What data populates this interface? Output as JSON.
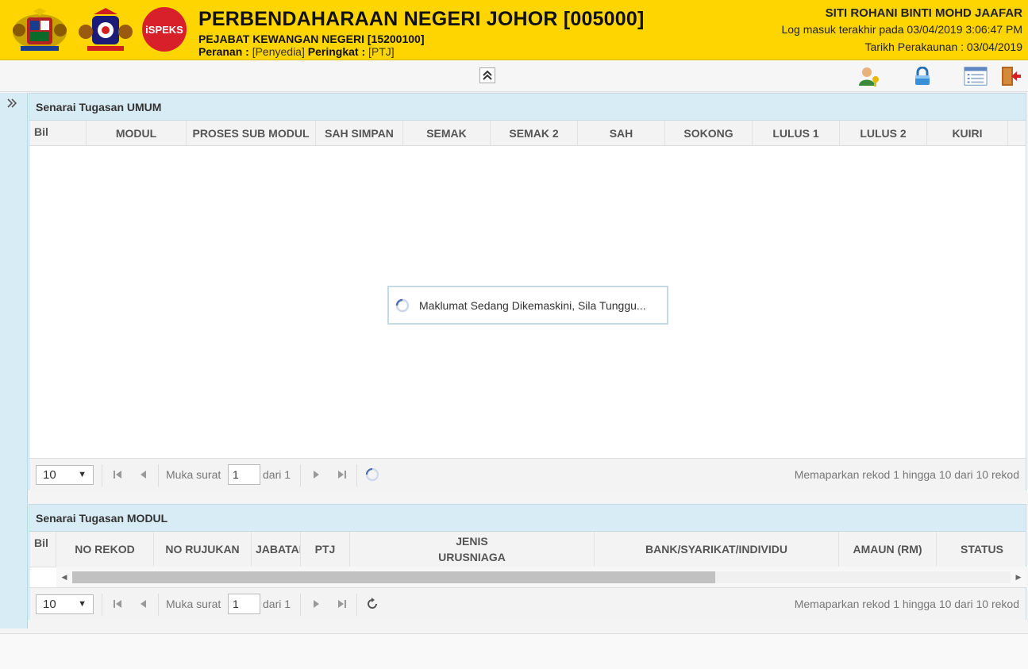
{
  "header": {
    "title": "PERBENDAHARAAN NEGERI JOHOR [005000]",
    "office": "PEJABAT KEWANGAN NEGERI [15200100]",
    "role_label": "Peranan :",
    "role_value": "[Penyedia]",
    "level_label": "Peringkat :",
    "level_value": "[PTJ]",
    "user_name": "SITI ROHANI BINTI MOHD JAAFAR",
    "last_login": "Log masuk terakhir pada 03/04/2019 3:06:47 PM",
    "accounting_date": "Tarikh Perakaunan : 03/04/2019",
    "logo_text": "iSPEKS",
    "colors": {
      "header_bg": "#ffd500",
      "panel_head_bg": "#d8ecf5"
    }
  },
  "toolbar": {
    "icons": [
      "collapse-up-icon",
      "user-key-icon",
      "lock-icon",
      "list-icon",
      "logout-icon"
    ]
  },
  "panel_umum": {
    "title": "Senarai Tugasan UMUM",
    "columns": [
      "Bil",
      "MODUL",
      "PROSES SUB MODUL",
      "SAH SIMPAN",
      "SEMAK",
      "SEMAK 2",
      "SAH",
      "SOKONG",
      "LULUS 1",
      "LULUS 2",
      "KUIRI"
    ],
    "loading_text": "Maklumat Sedang Dikemaskini, Sila Tunggu...",
    "pager": {
      "page_size": "10",
      "page_label": "Muka surat",
      "page_value": "1",
      "of_label": "dari 1",
      "info": "Memaparkan rekod 1 hingga 10 dari 10 rekod"
    }
  },
  "panel_modul": {
    "title": "Senarai Tugasan MODUL",
    "columns": [
      "Bil",
      "NO REKOD",
      "NO RUJUKAN",
      "JABATAN",
      "PTJ",
      "JENIS",
      "URUSNIAGA",
      "BANK/SYARIKAT/INDIVIDU",
      "AMAUN (RM)",
      "STATUS"
    ],
    "pager": {
      "page_size": "10",
      "page_label": "Muka surat",
      "page_value": "1",
      "of_label": "dari 1",
      "info": "Memaparkan rekod 1 hingga 10 dari 10 rekod"
    }
  }
}
